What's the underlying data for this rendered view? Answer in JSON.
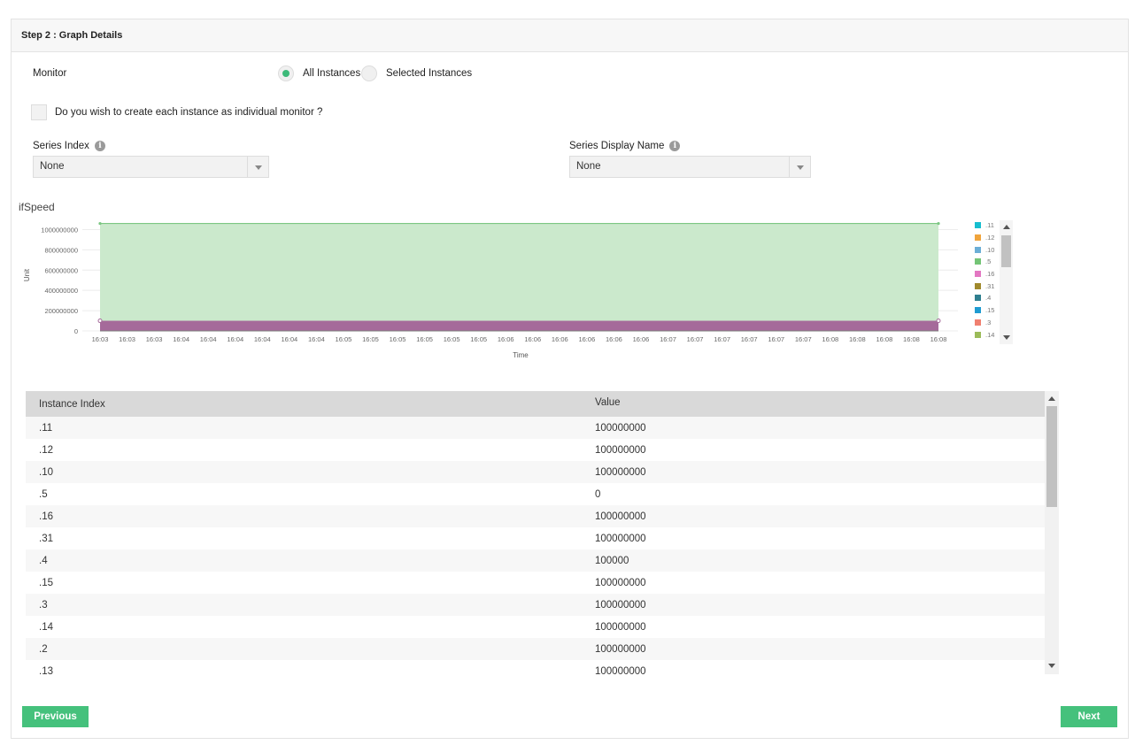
{
  "panel": {
    "title": "Step 2 : Graph Details"
  },
  "monitor": {
    "label": "Monitor",
    "option_all": "All Instances",
    "option_selected": "Selected Instances",
    "selected": "All Instances"
  },
  "individual_monitor": {
    "label": "Do you wish to create each instance as individual monitor ?",
    "checked": false
  },
  "series_index": {
    "label": "Series Index",
    "value": "None"
  },
  "series_display_name": {
    "label": "Series Display Name",
    "value": "None"
  },
  "icons": {
    "info": "info-icon",
    "dropdown": "chevron-down-icon"
  },
  "chart_data": {
    "type": "area",
    "title": "ifSpeed",
    "xlabel": "Time",
    "ylabel": "Unit",
    "ylim": [
      0,
      1100000000
    ],
    "y_ticks": [
      "0",
      "200000000",
      "400000000",
      "600000000",
      "800000000",
      "1000000000"
    ],
    "x_ticks": [
      "16:03",
      "16:03",
      "16:03",
      "16:04",
      "16:04",
      "16:04",
      "16:04",
      "16:04",
      "16:04",
      "16:05",
      "16:05",
      "16:05",
      "16:05",
      "16:05",
      "16:05",
      "16:06",
      "16:06",
      "16:06",
      "16:06",
      "16:06",
      "16:06",
      "16:07",
      "16:07",
      "16:07",
      "16:07",
      "16:07",
      "16:07",
      "16:08",
      "16:08",
      "16:08",
      "16:08",
      "16:08"
    ],
    "series": [
      {
        "name": ".11",
        "color": "#17becf",
        "value": 100000000
      },
      {
        "name": ".12",
        "color": "#f0a43c",
        "value": 100000000
      },
      {
        "name": ".10",
        "color": "#6baed6",
        "value": 100000000
      },
      {
        "name": ".5",
        "color": "#74c476",
        "value": 0
      },
      {
        "name": ".16",
        "color": "#e377c2",
        "value": 100000000
      },
      {
        "name": ".31",
        "color": "#a08a2d",
        "value": 100000000
      },
      {
        "name": ".4",
        "color": "#2f7f8f",
        "value": 100000
      },
      {
        "name": ".15",
        "color": "#1f9bd1",
        "value": 100000000
      },
      {
        "name": ".3",
        "color": "#f08070",
        "value": 100000000
      },
      {
        "name": ".14",
        "color": "#9bbb59",
        "value": 100000000
      }
    ],
    "highlight_series": {
      "value": 1060000000,
      "fill": "#cbe9cc",
      "stroke": "#7cc783"
    },
    "base_band": {
      "value": 100000000,
      "fill": "#a56a9a"
    },
    "legend_position": "right",
    "grid": true
  },
  "table": {
    "headers": [
      "Instance Index",
      "Value"
    ],
    "rows": [
      [
        ".11",
        "100000000"
      ],
      [
        ".12",
        "100000000"
      ],
      [
        ".10",
        "100000000"
      ],
      [
        ".5",
        "0"
      ],
      [
        ".16",
        "100000000"
      ],
      [
        ".31",
        "100000000"
      ],
      [
        ".4",
        "100000"
      ],
      [
        ".15",
        "100000000"
      ],
      [
        ".3",
        "100000000"
      ],
      [
        ".14",
        "100000000"
      ],
      [
        ".2",
        "100000000"
      ],
      [
        ".13",
        "100000000"
      ]
    ]
  },
  "buttons": {
    "previous": "Previous",
    "next": "Next"
  }
}
